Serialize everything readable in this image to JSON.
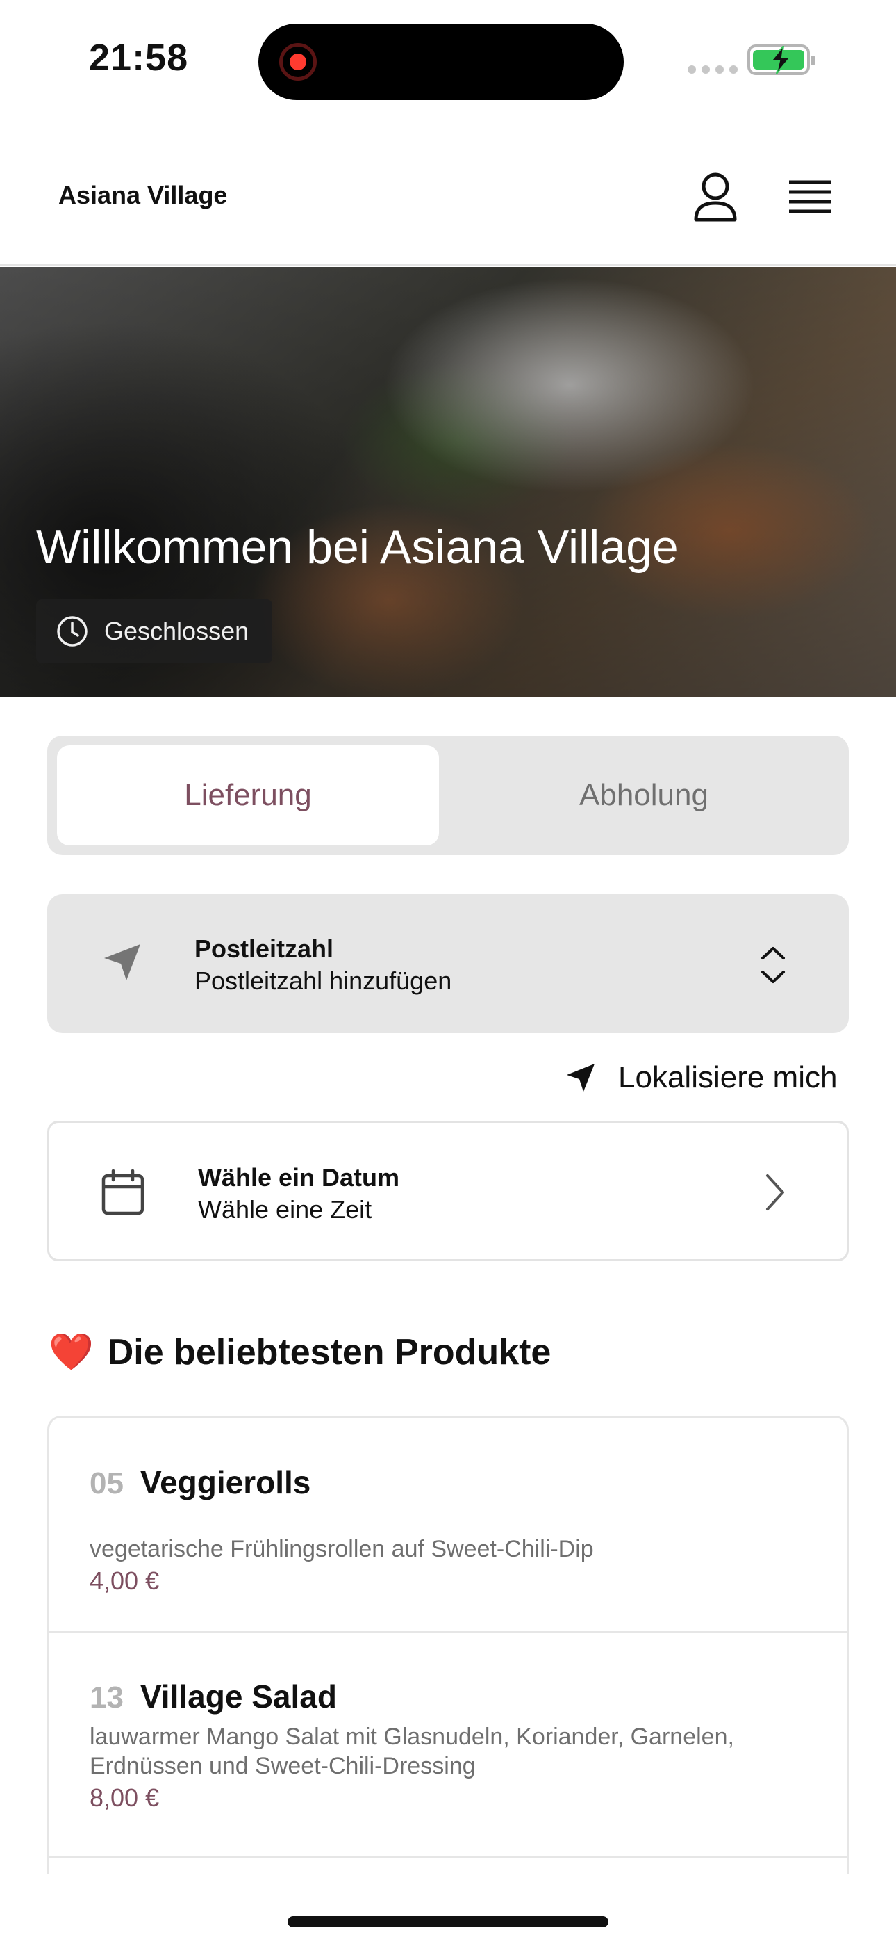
{
  "status_bar": {
    "time": "21:58"
  },
  "header": {
    "brand": "Asiana Village",
    "icons": {
      "user": "user-icon",
      "menu": "menu-icon"
    }
  },
  "hero": {
    "title": "Willkommen bei Asiana Village",
    "status_label": "Geschlossen"
  },
  "order_mode": {
    "options": [
      "Lieferung",
      "Abholung"
    ],
    "selected": "Lieferung"
  },
  "postcode": {
    "title": "Postleitzahl",
    "placeholder": "Postleitzahl hinzufügen"
  },
  "locate": {
    "label": "Lokalisiere mich"
  },
  "schedule": {
    "title": "Wähle ein Datum",
    "subtitle": "Wähle eine Zeit"
  },
  "popular": {
    "title": "Die beliebtesten Produkte",
    "emoji": "❤️",
    "items": [
      {
        "number": "05",
        "name": "Veggierolls",
        "description": "vegetarische Frühlingsrollen auf Sweet-Chili-Dip",
        "price": "4,00 €"
      },
      {
        "number": "13",
        "name": "Village Salad",
        "description": "lauwarmer Mango Salat mit Glasnudeln, Koriander, Garnelen, Erdnüssen und Sweet-Chili-Dressing",
        "price": "8,00 €"
      }
    ]
  },
  "colors": {
    "accent": "#7d4f60",
    "panel": "#e6e6e6",
    "battery": "#34c759",
    "record": "#ff3b30"
  }
}
